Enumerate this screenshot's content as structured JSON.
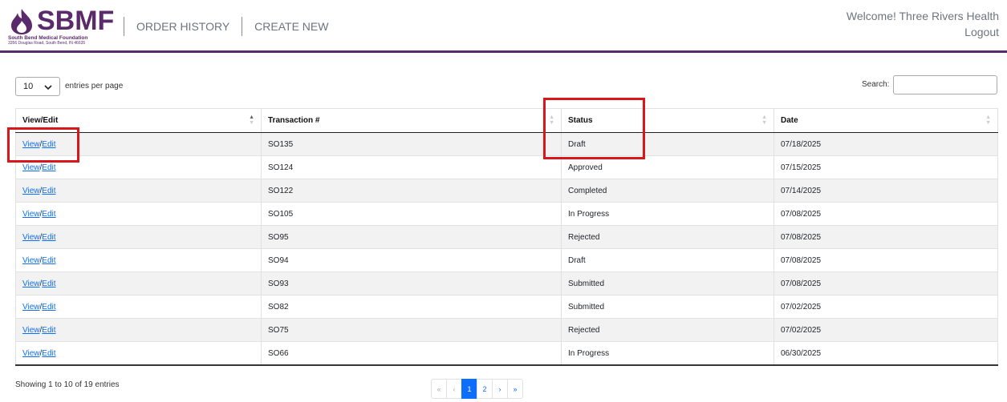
{
  "brand": {
    "name": "SBMF",
    "org": "South Bend Medical Foundation",
    "address": "3356 Douglas Road, South Bend, IN 46635",
    "color": "#5b2a6b"
  },
  "nav": {
    "order_history": "ORDER HISTORY",
    "create_new": "CREATE NEW"
  },
  "user": {
    "welcome": "Welcome! Three Rivers Health",
    "logout": "Logout"
  },
  "controls": {
    "page_length": "10",
    "entries_label": "entries per page",
    "search_label": "Search:",
    "search_value": ""
  },
  "table": {
    "columns": [
      "View/Edit",
      "Transaction #",
      "Status",
      "Date"
    ],
    "rows": [
      {
        "view": "View",
        "edit": "Edit",
        "transaction": "SO135",
        "status": "Draft",
        "date": "07/18/2025"
      },
      {
        "view": "View",
        "edit": "Edit",
        "transaction": "SO124",
        "status": "Approved",
        "date": "07/15/2025"
      },
      {
        "view": "View",
        "edit": "Edit",
        "transaction": "SO122",
        "status": "Completed",
        "date": "07/14/2025"
      },
      {
        "view": "View",
        "edit": "Edit",
        "transaction": "SO105",
        "status": "In Progress",
        "date": "07/08/2025"
      },
      {
        "view": "View",
        "edit": "Edit",
        "transaction": "SO95",
        "status": "Rejected",
        "date": "07/08/2025"
      },
      {
        "view": "View",
        "edit": "Edit",
        "transaction": "SO94",
        "status": "Draft",
        "date": "07/08/2025"
      },
      {
        "view": "View",
        "edit": "Edit",
        "transaction": "SO93",
        "status": "Submitted",
        "date": "07/08/2025"
      },
      {
        "view": "View",
        "edit": "Edit",
        "transaction": "SO82",
        "status": "Submitted",
        "date": "07/02/2025"
      },
      {
        "view": "View",
        "edit": "Edit",
        "transaction": "SO75",
        "status": "Rejected",
        "date": "07/02/2025"
      },
      {
        "view": "View",
        "edit": "Edit",
        "transaction": "SO66",
        "status": "In Progress",
        "date": "06/30/2025"
      }
    ]
  },
  "footer": {
    "info": "Showing 1 to 10 of 19 entries",
    "pagination": {
      "first": "«",
      "prev": "‹",
      "pages": [
        "1",
        "2"
      ],
      "current": "1",
      "next": "›",
      "last": "»"
    }
  },
  "colors": {
    "link": "#0d6efd",
    "highlight": "#d9161a",
    "header_rule": "#5b2a6b"
  }
}
